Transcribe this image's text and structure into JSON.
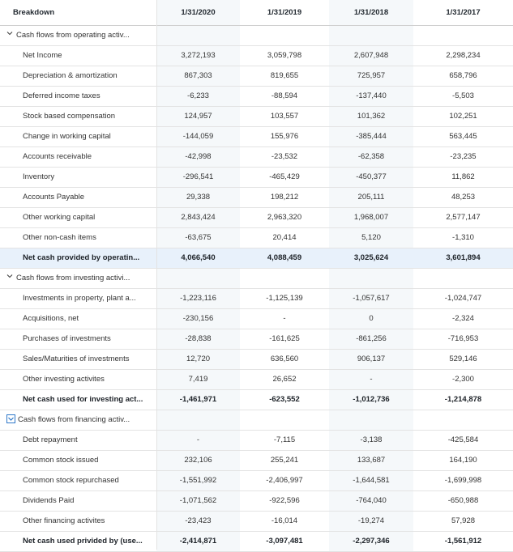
{
  "header": {
    "breakdown": "Breakdown",
    "cols": [
      "1/31/2020",
      "1/31/2019",
      "1/31/2018",
      "1/31/2017"
    ]
  },
  "rows": [
    {
      "label": "Cash flows from operating activ...",
      "type": "section",
      "icon": "chevron-down-icon",
      "values": [
        "",
        "",
        "",
        ""
      ]
    },
    {
      "label": "Net Income",
      "values": [
        "3,272,193",
        "3,059,798",
        "2,607,948",
        "2,298,234"
      ]
    },
    {
      "label": "Depreciation & amortization",
      "values": [
        "867,303",
        "819,655",
        "725,957",
        "658,796"
      ]
    },
    {
      "label": "Deferred income taxes",
      "values": [
        "-6,233",
        "-88,594",
        "-137,440",
        "-5,503"
      ]
    },
    {
      "label": "Stock based compensation",
      "values": [
        "124,957",
        "103,557",
        "101,362",
        "102,251"
      ]
    },
    {
      "label": "Change in working capital",
      "values": [
        "-144,059",
        "155,976",
        "-385,444",
        "563,445"
      ]
    },
    {
      "label": "Accounts receivable",
      "values": [
        "-42,998",
        "-23,532",
        "-62,358",
        "-23,235"
      ]
    },
    {
      "label": "Inventory",
      "values": [
        "-296,541",
        "-465,429",
        "-450,377",
        "11,862"
      ]
    },
    {
      "label": "Accounts Payable",
      "values": [
        "29,338",
        "198,212",
        "205,111",
        "48,253"
      ]
    },
    {
      "label": "Other working capital",
      "values": [
        "2,843,424",
        "2,963,320",
        "1,968,007",
        "2,577,147"
      ]
    },
    {
      "label": "Other non-cash items",
      "values": [
        "-63,675",
        "20,414",
        "5,120",
        "-1,310"
      ]
    },
    {
      "label": "Net cash provided by operatin...",
      "type": "total-highlight",
      "values": [
        "4,066,540",
        "4,088,459",
        "3,025,624",
        "3,601,894"
      ]
    },
    {
      "label": "Cash flows from investing activi...",
      "type": "section",
      "icon": "chevron-down-icon",
      "values": [
        "",
        "",
        "",
        ""
      ]
    },
    {
      "label": "Investments in property, plant a...",
      "values": [
        "-1,223,116",
        "-1,125,139",
        "-1,057,617",
        "-1,024,747"
      ]
    },
    {
      "label": "Acquisitions, net",
      "values": [
        "-230,156",
        "-",
        "0",
        "-2,324"
      ]
    },
    {
      "label": "Purchases of investments",
      "values": [
        "-28,838",
        "-161,625",
        "-861,256",
        "-716,953"
      ]
    },
    {
      "label": "Sales/Maturities of investments",
      "values": [
        "12,720",
        "636,560",
        "906,137",
        "529,146"
      ]
    },
    {
      "label": "Other investing activites",
      "values": [
        "7,419",
        "26,652",
        "-",
        "-2,300"
      ]
    },
    {
      "label": "Net cash used for investing act...",
      "type": "total",
      "values": [
        "-1,461,971",
        "-623,552",
        "-1,012,736",
        "-1,214,878"
      ]
    },
    {
      "label": "Cash flows from financing activ...",
      "type": "section",
      "icon": "checkbox-chevron-icon",
      "values": [
        "",
        "",
        "",
        ""
      ]
    },
    {
      "label": "Debt repayment",
      "values": [
        "-",
        "-7,115",
        "-3,138",
        "-425,584"
      ]
    },
    {
      "label": "Common stock issued",
      "values": [
        "232,106",
        "255,241",
        "133,687",
        "164,190"
      ]
    },
    {
      "label": "Common stock repurchased",
      "values": [
        "-1,551,992",
        "-2,406,997",
        "-1,644,581",
        "-1,699,998"
      ]
    },
    {
      "label": "Dividends Paid",
      "values": [
        "-1,071,562",
        "-922,596",
        "-764,040",
        "-650,988"
      ]
    },
    {
      "label": "Other financing activites",
      "values": [
        "-23,423",
        "-16,014",
        "-19,274",
        "57,928"
      ]
    },
    {
      "label": "Net cash used privided by (use...",
      "type": "total",
      "values": [
        "-2,414,871",
        "-3,097,481",
        "-2,297,346",
        "-1,561,912"
      ]
    }
  ]
}
